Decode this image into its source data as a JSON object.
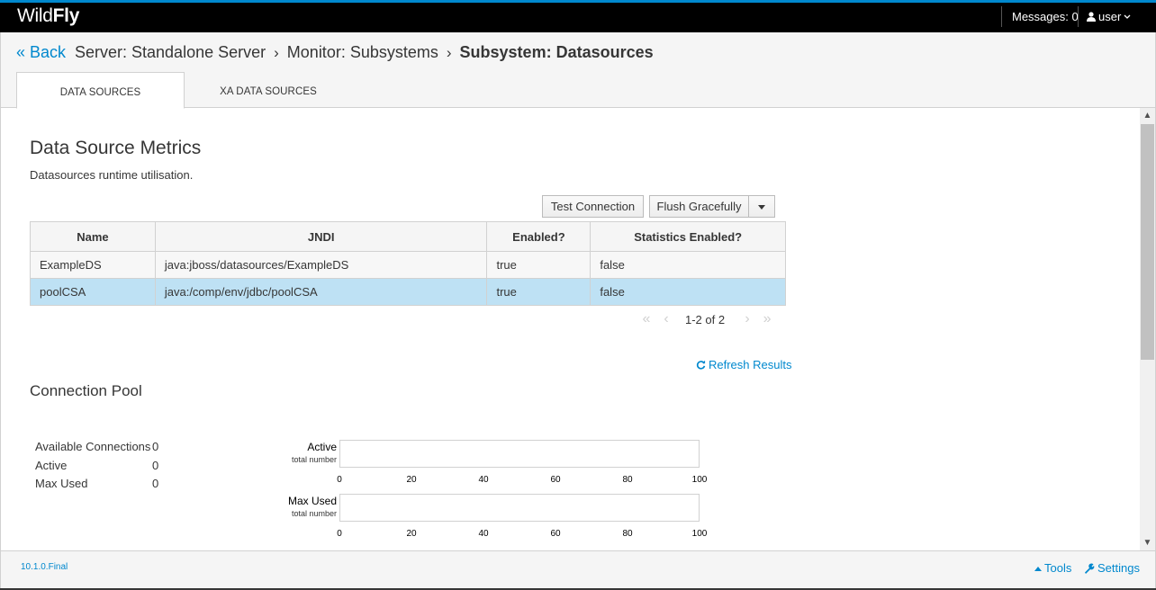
{
  "brand": {
    "part1": "Wild",
    "part2": "Fly"
  },
  "topnav": {
    "messages": "Messages: 0",
    "user": "user"
  },
  "breadcrumb": {
    "back": "Back",
    "items": [
      "Server: Standalone Server",
      "Monitor: Subsystems",
      "Subsystem: Datasources"
    ]
  },
  "tabs": [
    "DATA SOURCES",
    "XA DATA SOURCES"
  ],
  "metrics": {
    "title": "Data Source Metrics",
    "description": "Datasources runtime utilisation.",
    "test_connection": "Test Connection",
    "flush_gracefully": "Flush Gracefully"
  },
  "table": {
    "headers": [
      "Name",
      "JNDI",
      "Enabled?",
      "Statistics Enabled?"
    ],
    "rows": [
      [
        "ExampleDS",
        "java:jboss/datasources/ExampleDS",
        "true",
        "false"
      ],
      [
        "poolCSA",
        "java:/comp/env/jdbc/poolCSA",
        "true",
        "false"
      ]
    ],
    "selected_row": 1
  },
  "pager": {
    "text": "1-2 of 2"
  },
  "refresh": "Refresh Results",
  "pool": {
    "title": "Connection Pool",
    "stats": [
      {
        "label": "Available Connections",
        "value": "0"
      },
      {
        "label": "Active",
        "value": "0"
      },
      {
        "label": "Max Used",
        "value": "0"
      }
    ],
    "bars": [
      {
        "label": "Active",
        "sublabel": "total number",
        "value": 0
      },
      {
        "label": "Max Used",
        "sublabel": "total number",
        "value": 0
      }
    ],
    "ticks": [
      "0",
      "20",
      "40",
      "60",
      "80",
      "100"
    ],
    "max": 100
  },
  "footer": {
    "version": "10.1.0.Final",
    "tools": "Tools",
    "settings": "Settings"
  },
  "colors": {
    "accent": "#0088ce",
    "selected_row": "#bee1f4",
    "topbar": "#000000"
  }
}
